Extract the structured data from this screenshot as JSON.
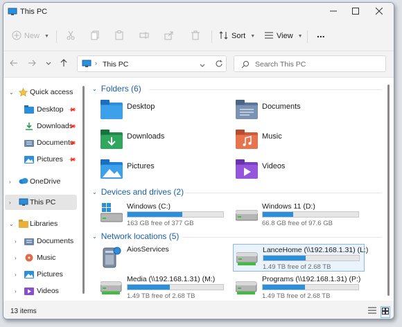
{
  "window": {
    "title": "This PC",
    "controls": [
      "minimize-icon",
      "maximize-icon",
      "close-icon"
    ]
  },
  "toolbar": {
    "new_label": "New",
    "sort_label": "Sort",
    "view_label": "View",
    "more_label": "..."
  },
  "address": {
    "path": "This PC",
    "search_placeholder": "Search This PC"
  },
  "sidebar": {
    "items": [
      {
        "label": "Quick access",
        "icon": "star-icon",
        "expanded": true
      },
      {
        "label": "Desktop",
        "icon": "desktop-folder-icon",
        "pinned": true
      },
      {
        "label": "Downloads",
        "icon": "downloads-folder-icon",
        "pinned": true
      },
      {
        "label": "Documents",
        "icon": "documents-folder-icon",
        "pinned": true
      },
      {
        "label": "Pictures",
        "icon": "pictures-folder-icon",
        "pinned": true
      },
      {
        "label": "OneDrive",
        "icon": "cloud-icon"
      },
      {
        "label": "This PC",
        "icon": "monitor-icon",
        "selected": true
      },
      {
        "label": "Libraries",
        "icon": "libraries-icon",
        "expanded": true
      },
      {
        "label": "Documents",
        "icon": "documents-folder-icon"
      },
      {
        "label": "Music",
        "icon": "music-icon"
      },
      {
        "label": "Pictures",
        "icon": "pictures-folder-icon"
      },
      {
        "label": "Videos",
        "icon": "videos-icon"
      }
    ]
  },
  "groups": {
    "folders": {
      "header": "Folders (6)",
      "items": [
        "Desktop",
        "Documents",
        "Downloads",
        "Music",
        "Pictures",
        "Videos"
      ]
    },
    "devices": {
      "header": "Devices and drives (2)",
      "items": [
        {
          "name": "Windows (C:)",
          "free": "163 GB free of 377 GB",
          "used_fraction": 0.57
        },
        {
          "name": "Windows 11 (D:)",
          "free": "66.8 GB free of 97.6 GB",
          "used_fraction": 0.32
        }
      ]
    },
    "network": {
      "header": "Network locations (5)",
      "items": [
        {
          "name": "AiosServices"
        },
        {
          "name": "LanceHome (\\\\192.168.1.31) (L:)",
          "free": "1.49 TB free of 2.68 TB",
          "used_fraction": 0.44
        },
        {
          "name": "Media (\\\\192.168.1.31) (M:)",
          "free": "1.49 TB free of 2.68 TB",
          "used_fraction": 0.44
        },
        {
          "name": "Programs (\\\\192.168.1.31) (P:)",
          "free": "1.49 TB free of 2.68 TB",
          "used_fraction": 0.44
        }
      ]
    }
  },
  "status": {
    "count": "13 items"
  },
  "colors": {
    "accent": "#2b8fd9",
    "group_header": "#1a5fa8"
  }
}
